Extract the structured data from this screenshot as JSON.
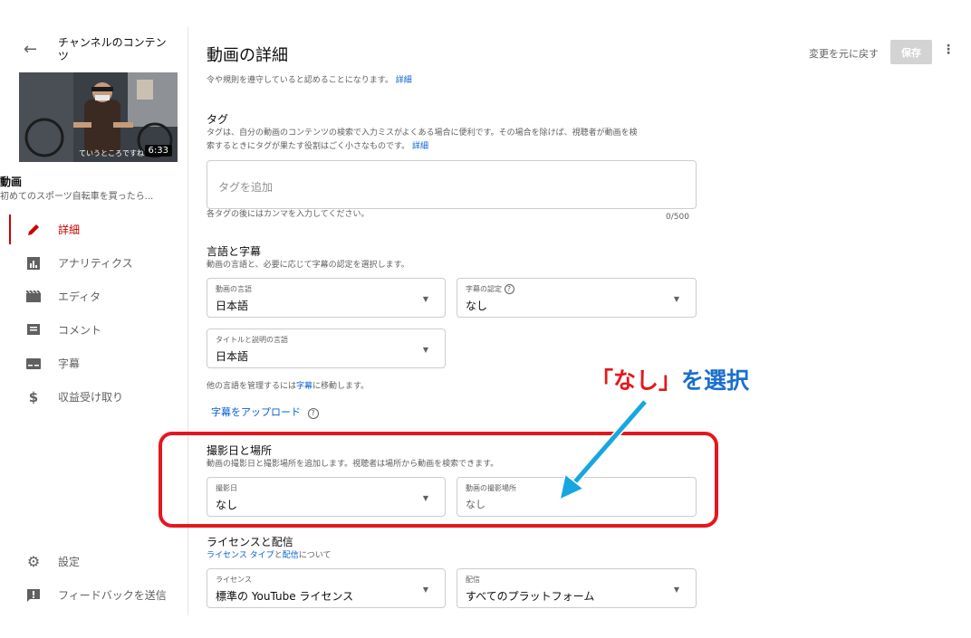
{
  "sidebar": {
    "back_icon": "arrow-left-icon",
    "channel_title": "チャンネルのコンテンツ",
    "thumbnail_caption": "ていうところですね",
    "duration": "6:33",
    "video_label": "動画",
    "video_subtitle": "初めてのスポーツ自転車を買ったら...",
    "items": [
      {
        "label": "詳細",
        "icon": "pencil-icon",
        "active": true
      },
      {
        "label": "アナリティクス",
        "icon": "analytics-icon",
        "active": false
      },
      {
        "label": "エディタ",
        "icon": "editor-icon",
        "active": false
      },
      {
        "label": "コメント",
        "icon": "comment-icon",
        "active": false
      },
      {
        "label": "字幕",
        "icon": "subtitles-icon",
        "active": false
      },
      {
        "label": "収益受け取り",
        "icon": "dollar-icon",
        "active": false
      }
    ],
    "bottom_items": [
      {
        "label": "設定",
        "icon": "gear-icon"
      },
      {
        "label": "フィードバックを送信",
        "icon": "feedback-icon"
      }
    ]
  },
  "header": {
    "title": "動画の詳細",
    "undo_label": "変更を元に戻す",
    "save_label": "保存"
  },
  "content": {
    "top_text": "令や規則を遵守していると認めることになります。",
    "top_link": "詳細",
    "tags": {
      "title": "タグ",
      "description_line1": "タグは、自分の動画のコンテンツの検索で入力ミスがよくある場合に便利です。その場合を除けば、視聴者が動画を検",
      "description_line2": "索するときにタグが果たす役割はごく小さなものです。",
      "link": "詳細",
      "placeholder": "タグを追加",
      "hint": "各タグの後にはカンマを入力してください。",
      "counter": "0/500"
    },
    "language": {
      "title": "言語と字幕",
      "description": "動画の言語と、必要に応じて字幕の認定を選択します。",
      "video_language_label": "動画の言語",
      "video_language_value": "日本語",
      "caption_cert_label": "字幕の認定",
      "caption_cert_value": "なし",
      "title_language_label": "タイトルと説明の言語",
      "title_language_value": "日本語",
      "manage_prefix": "他の言語を管理するには",
      "manage_link": "字幕",
      "manage_suffix": "に移動します。",
      "upload_link": "字幕をアップロード"
    },
    "recording": {
      "title": "撮影日と場所",
      "description": "動画の撮影日と撮影場所を追加します。視聴者は場所から動画を検索できます。",
      "date_label": "撮影日",
      "date_value": "なし",
      "location_label": "動画の撮影場所",
      "location_value": "なし"
    },
    "license": {
      "title": "ライセンスと配信",
      "link1": "ライセンス タイプ",
      "and": "と",
      "link2": "配信",
      "about": "について",
      "license_label": "ライセンス",
      "license_value": "標準の YouTube ライセンス",
      "distribution_label": "配信",
      "distribution_value": "すべてのプラットフォーム"
    }
  },
  "annotation": {
    "quoted": "「なし」",
    "action": "を選択"
  },
  "colors": {
    "accent_red": "#cc0000",
    "link_blue": "#065fd4",
    "annotation_red": "#e4181d",
    "arrow_blue": "#17a7e0"
  }
}
